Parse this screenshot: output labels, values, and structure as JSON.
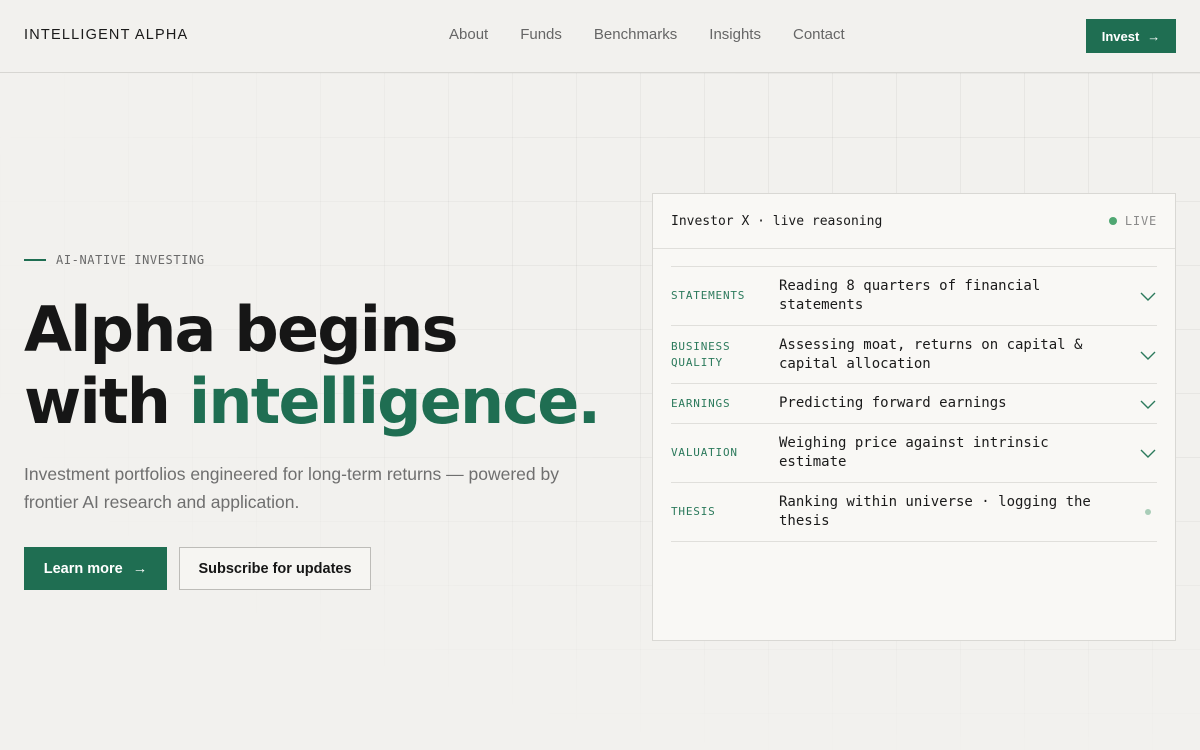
{
  "header": {
    "logo": "INTELLIGENT ALPHA",
    "nav": [
      "About",
      "Funds",
      "Benchmarks",
      "Insights",
      "Contact"
    ],
    "invest_label": "Invest",
    "arrow": "→"
  },
  "hero": {
    "eyebrow": "AI-NATIVE INVESTING",
    "title_line1": "Alpha begins",
    "title_line2_plain": "with ",
    "title_line2_accent": "intelligence.",
    "lede": "Investment portfolios engineered for long-term returns — powered by frontier AI research and application.",
    "primary_cta": "Learn more",
    "secondary_cta": "Subscribe for updates",
    "arrow": "→"
  },
  "panel": {
    "title": "Investor X · live reasoning",
    "status": "LIVE",
    "rows": [
      {
        "label": "STATEMENTS",
        "desc": "Reading 8 quarters of financial statements",
        "icon": "chevron-down-icon"
      },
      {
        "label": "BUSINESS QUALITY",
        "desc": "Assessing moat, returns on capital & capital allocation",
        "icon": "chevron-down-icon"
      },
      {
        "label": "EARNINGS",
        "desc": "Predicting forward earnings",
        "icon": "chevron-down-icon"
      },
      {
        "label": "VALUATION",
        "desc": "Weighing price against intrinsic estimate",
        "icon": "chevron-down-icon"
      },
      {
        "label": "THESIS",
        "desc": "Ranking within universe · logging the thesis",
        "icon": "pending-dot-icon"
      }
    ]
  },
  "colors": {
    "accent": "#1f6e52",
    "background": "#f2f1ee",
    "live": "#4fa772"
  }
}
